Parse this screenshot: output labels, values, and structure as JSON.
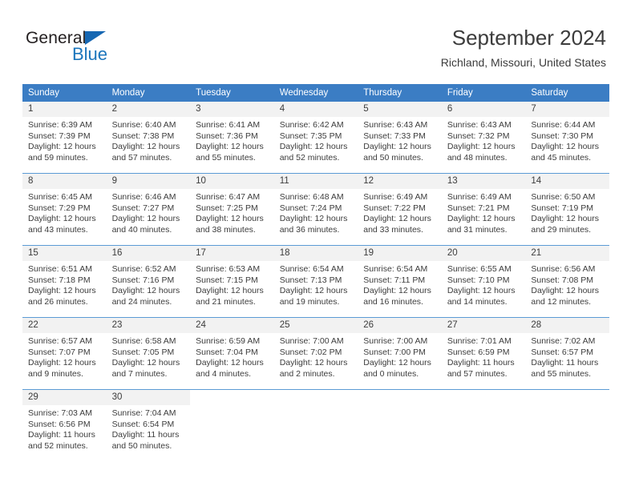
{
  "brand": {
    "name_part1": "General",
    "name_part2": "Blue",
    "triangle_color": "#1667b2",
    "blue_color": "#1b75bc"
  },
  "header": {
    "title": "September 2024",
    "subtitle": "Richland, Missouri, United States"
  },
  "theme": {
    "header_band": "#3b7dc4",
    "row_divider": "#5b9bd5",
    "daynum_band": "#f2f2f2",
    "text": "#3c3c3c"
  },
  "weekdays": [
    "Sunday",
    "Monday",
    "Tuesday",
    "Wednesday",
    "Thursday",
    "Friday",
    "Saturday"
  ],
  "labels": {
    "sunrise": "Sunrise:",
    "sunset": "Sunset:",
    "daylight": "Daylight:"
  },
  "weeks": [
    [
      {
        "day": "1",
        "sunrise": "Sunrise: 6:39 AM",
        "sunset": "Sunset: 7:39 PM",
        "daylight": "Daylight: 12 hours and 59 minutes."
      },
      {
        "day": "2",
        "sunrise": "Sunrise: 6:40 AM",
        "sunset": "Sunset: 7:38 PM",
        "daylight": "Daylight: 12 hours and 57 minutes."
      },
      {
        "day": "3",
        "sunrise": "Sunrise: 6:41 AM",
        "sunset": "Sunset: 7:36 PM",
        "daylight": "Daylight: 12 hours and 55 minutes."
      },
      {
        "day": "4",
        "sunrise": "Sunrise: 6:42 AM",
        "sunset": "Sunset: 7:35 PM",
        "daylight": "Daylight: 12 hours and 52 minutes."
      },
      {
        "day": "5",
        "sunrise": "Sunrise: 6:43 AM",
        "sunset": "Sunset: 7:33 PM",
        "daylight": "Daylight: 12 hours and 50 minutes."
      },
      {
        "day": "6",
        "sunrise": "Sunrise: 6:43 AM",
        "sunset": "Sunset: 7:32 PM",
        "daylight": "Daylight: 12 hours and 48 minutes."
      },
      {
        "day": "7",
        "sunrise": "Sunrise: 6:44 AM",
        "sunset": "Sunset: 7:30 PM",
        "daylight": "Daylight: 12 hours and 45 minutes."
      }
    ],
    [
      {
        "day": "8",
        "sunrise": "Sunrise: 6:45 AM",
        "sunset": "Sunset: 7:29 PM",
        "daylight": "Daylight: 12 hours and 43 minutes."
      },
      {
        "day": "9",
        "sunrise": "Sunrise: 6:46 AM",
        "sunset": "Sunset: 7:27 PM",
        "daylight": "Daylight: 12 hours and 40 minutes."
      },
      {
        "day": "10",
        "sunrise": "Sunrise: 6:47 AM",
        "sunset": "Sunset: 7:25 PM",
        "daylight": "Daylight: 12 hours and 38 minutes."
      },
      {
        "day": "11",
        "sunrise": "Sunrise: 6:48 AM",
        "sunset": "Sunset: 7:24 PM",
        "daylight": "Daylight: 12 hours and 36 minutes."
      },
      {
        "day": "12",
        "sunrise": "Sunrise: 6:49 AM",
        "sunset": "Sunset: 7:22 PM",
        "daylight": "Daylight: 12 hours and 33 minutes."
      },
      {
        "day": "13",
        "sunrise": "Sunrise: 6:49 AM",
        "sunset": "Sunset: 7:21 PM",
        "daylight": "Daylight: 12 hours and 31 minutes."
      },
      {
        "day": "14",
        "sunrise": "Sunrise: 6:50 AM",
        "sunset": "Sunset: 7:19 PM",
        "daylight": "Daylight: 12 hours and 29 minutes."
      }
    ],
    [
      {
        "day": "15",
        "sunrise": "Sunrise: 6:51 AM",
        "sunset": "Sunset: 7:18 PM",
        "daylight": "Daylight: 12 hours and 26 minutes."
      },
      {
        "day": "16",
        "sunrise": "Sunrise: 6:52 AM",
        "sunset": "Sunset: 7:16 PM",
        "daylight": "Daylight: 12 hours and 24 minutes."
      },
      {
        "day": "17",
        "sunrise": "Sunrise: 6:53 AM",
        "sunset": "Sunset: 7:15 PM",
        "daylight": "Daylight: 12 hours and 21 minutes."
      },
      {
        "day": "18",
        "sunrise": "Sunrise: 6:54 AM",
        "sunset": "Sunset: 7:13 PM",
        "daylight": "Daylight: 12 hours and 19 minutes."
      },
      {
        "day": "19",
        "sunrise": "Sunrise: 6:54 AM",
        "sunset": "Sunset: 7:11 PM",
        "daylight": "Daylight: 12 hours and 16 minutes."
      },
      {
        "day": "20",
        "sunrise": "Sunrise: 6:55 AM",
        "sunset": "Sunset: 7:10 PM",
        "daylight": "Daylight: 12 hours and 14 minutes."
      },
      {
        "day": "21",
        "sunrise": "Sunrise: 6:56 AM",
        "sunset": "Sunset: 7:08 PM",
        "daylight": "Daylight: 12 hours and 12 minutes."
      }
    ],
    [
      {
        "day": "22",
        "sunrise": "Sunrise: 6:57 AM",
        "sunset": "Sunset: 7:07 PM",
        "daylight": "Daylight: 12 hours and 9 minutes."
      },
      {
        "day": "23",
        "sunrise": "Sunrise: 6:58 AM",
        "sunset": "Sunset: 7:05 PM",
        "daylight": "Daylight: 12 hours and 7 minutes."
      },
      {
        "day": "24",
        "sunrise": "Sunrise: 6:59 AM",
        "sunset": "Sunset: 7:04 PM",
        "daylight": "Daylight: 12 hours and 4 minutes."
      },
      {
        "day": "25",
        "sunrise": "Sunrise: 7:00 AM",
        "sunset": "Sunset: 7:02 PM",
        "daylight": "Daylight: 12 hours and 2 minutes."
      },
      {
        "day": "26",
        "sunrise": "Sunrise: 7:00 AM",
        "sunset": "Sunset: 7:00 PM",
        "daylight": "Daylight: 12 hours and 0 minutes."
      },
      {
        "day": "27",
        "sunrise": "Sunrise: 7:01 AM",
        "sunset": "Sunset: 6:59 PM",
        "daylight": "Daylight: 11 hours and 57 minutes."
      },
      {
        "day": "28",
        "sunrise": "Sunrise: 7:02 AM",
        "sunset": "Sunset: 6:57 PM",
        "daylight": "Daylight: 11 hours and 55 minutes."
      }
    ],
    [
      {
        "day": "29",
        "sunrise": "Sunrise: 7:03 AM",
        "sunset": "Sunset: 6:56 PM",
        "daylight": "Daylight: 11 hours and 52 minutes."
      },
      {
        "day": "30",
        "sunrise": "Sunrise: 7:04 AM",
        "sunset": "Sunset: 6:54 PM",
        "daylight": "Daylight: 11 hours and 50 minutes."
      },
      {
        "day": "",
        "sunrise": "",
        "sunset": "",
        "daylight": ""
      },
      {
        "day": "",
        "sunrise": "",
        "sunset": "",
        "daylight": ""
      },
      {
        "day": "",
        "sunrise": "",
        "sunset": "",
        "daylight": ""
      },
      {
        "day": "",
        "sunrise": "",
        "sunset": "",
        "daylight": ""
      },
      {
        "day": "",
        "sunrise": "",
        "sunset": "",
        "daylight": ""
      }
    ]
  ]
}
